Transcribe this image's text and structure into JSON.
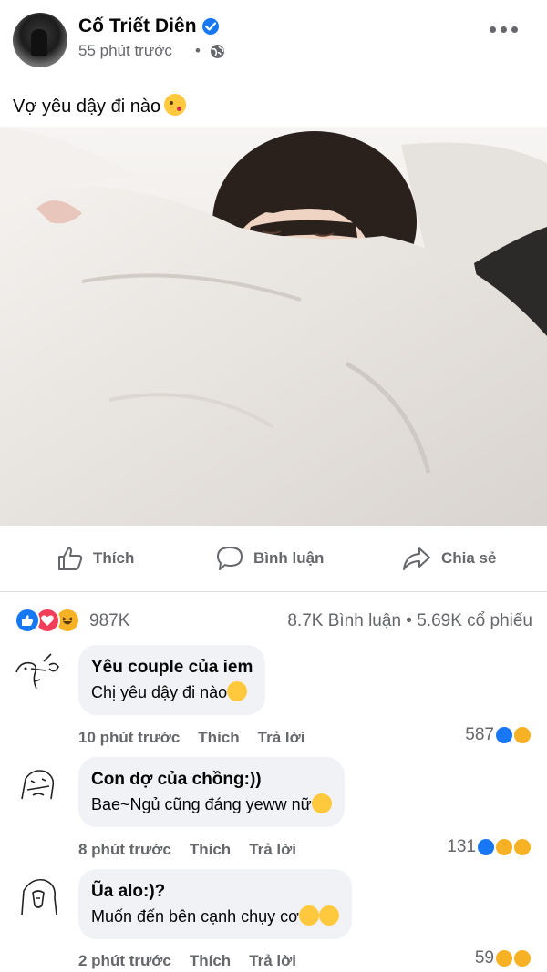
{
  "post": {
    "author": "Cố Triết Diên",
    "time": "55 phút trước",
    "dot": "•",
    "text": "Vợ yêu dậy đi nào"
  },
  "actions": {
    "like": "Thích",
    "comment": "Bình luận",
    "share": "Chia sẻ"
  },
  "stats": {
    "reactions": "987K",
    "comments_shares": "8.7K Bình luận • 5.69K cổ phiếu"
  },
  "comments": [
    {
      "author": "Yêu couple của iem",
      "text": "Chị yêu dậy đi nào",
      "time": "10 phút trước",
      "like": "Thích",
      "reply": "Trả lời",
      "count": "587",
      "reactions": [
        "like",
        "haha"
      ]
    },
    {
      "author": "Con dợ của chồng:))",
      "text": "Bae~Ngủ cũng đáng yeww nữ",
      "time": "8 phút trước",
      "like": "Thích",
      "reply": "Trả lời",
      "count": "131",
      "reactions": [
        "like",
        "care",
        "haha"
      ]
    },
    {
      "author": "Ũa alo:)?",
      "text": "Muốn đến bên cạnh chụy cơ",
      "time": "2 phút trước",
      "like": "Thích",
      "reply": "Trả lời",
      "count": "59",
      "reactions": [
        "haha",
        "sad"
      ]
    }
  ],
  "colors": {
    "accent": "#1877f2",
    "secondary_text": "#65676b",
    "bubble": "#f0f2f5",
    "love": "#f33e58",
    "haha": "#f7b125"
  }
}
